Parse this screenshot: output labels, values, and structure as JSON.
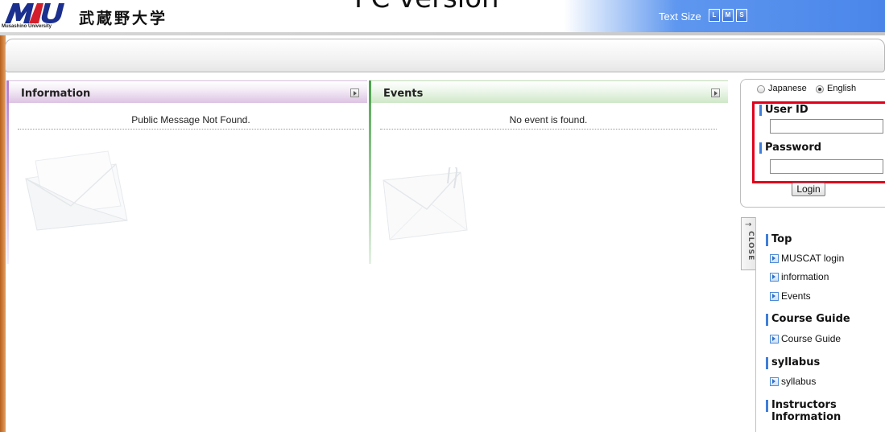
{
  "header": {
    "logo_initials": "MU",
    "logo_caption": "Musashino University",
    "logo_name": "武蔵野大学",
    "overlay_title": "PC version",
    "text_size_label": "Text Size",
    "text_size_options": [
      "L",
      "M",
      "S"
    ]
  },
  "information": {
    "title": "Information",
    "message": "Public Message Not Found."
  },
  "events": {
    "title": "Events",
    "message": "No event is found."
  },
  "login": {
    "language_options": [
      {
        "label": "Japanese",
        "selected": false
      },
      {
        "label": "English",
        "selected": true
      }
    ],
    "user_id_label": "User ID",
    "user_id_value": "",
    "password_label": "Password",
    "password_value": "",
    "login_button": "Login"
  },
  "side_menu": {
    "close_label": "CLOSE",
    "sections": [
      {
        "heading": "Top",
        "items": [
          "MUSCAT login",
          "information",
          "Events"
        ]
      },
      {
        "heading": "Course Guide",
        "items": [
          "Course Guide"
        ]
      },
      {
        "heading": "syllabus",
        "items": [
          "syllabus"
        ]
      },
      {
        "heading": "Instructors Information",
        "items": []
      }
    ]
  },
  "colors": {
    "accent_blue": "#3f7fd9",
    "header_blue": "#4a86ea",
    "information_stripe": "#b57cc7",
    "events_stripe": "#4aa24a",
    "highlight_red": "#e0001b"
  }
}
